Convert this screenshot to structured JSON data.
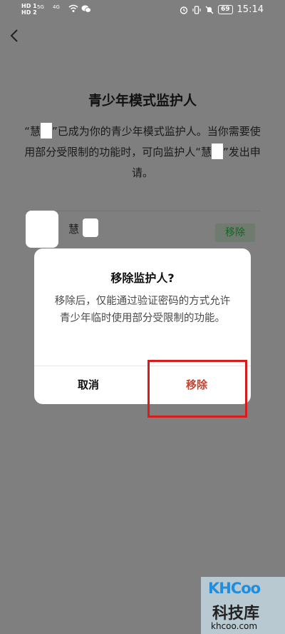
{
  "status_bar": {
    "sim1": "HD 1",
    "sim2": "HD 2",
    "network1": "5G",
    "network2": "4G",
    "battery": "69",
    "time": "15:14"
  },
  "page": {
    "title": "青少年模式监护人",
    "desc_part1": "“慧",
    "desc_part2": "”已成为你的青少年模式监护人。当你需要使用部分受限制的功能时，可向监护人“慧",
    "desc_part3": "”发出申请。"
  },
  "guardian": {
    "name": "慧",
    "remove_label": "移除"
  },
  "dialog": {
    "title": "移除监护人?",
    "message": "移除后，仅能通过验证密码的方式允许青少年临时使用部分受限制的功能。",
    "cancel_label": "取消",
    "confirm_label": "移除"
  },
  "watermark": {
    "logo": "KHCoo",
    "cn": "科技库",
    "url": "khcoo.com"
  },
  "colors": {
    "overlay_bg": "#7f7f7f",
    "confirm_red": "#c5432f",
    "highlight_red": "#d61d1d",
    "remove_green": "#0b6b23"
  }
}
